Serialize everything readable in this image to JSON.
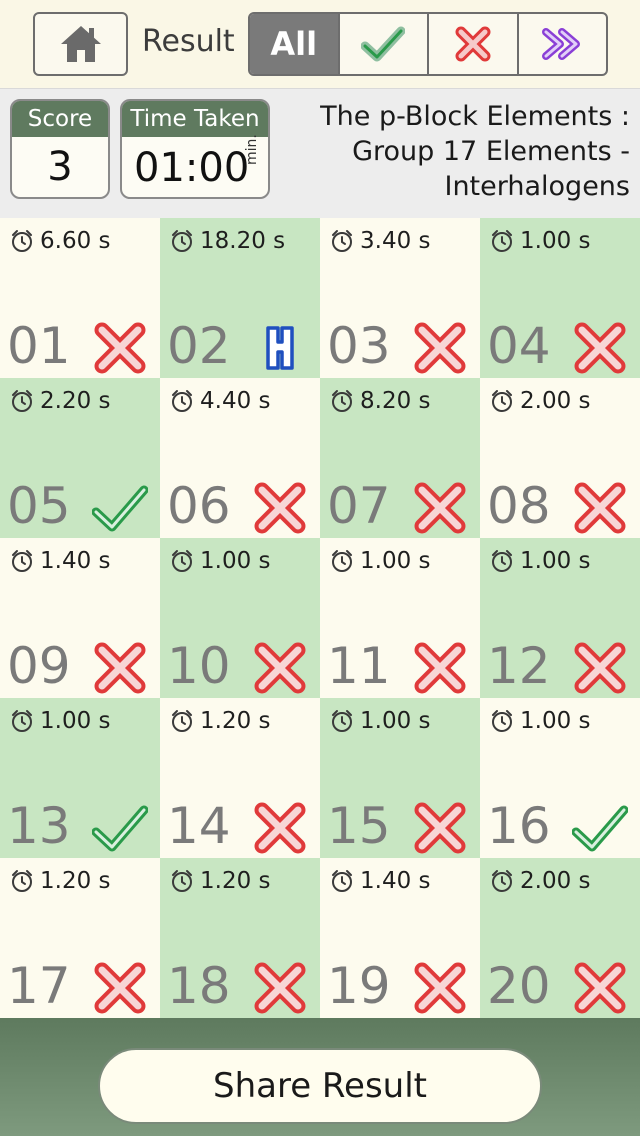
{
  "toolbar": {
    "result_label": "Result",
    "filters": [
      "All",
      "correct",
      "wrong",
      "skipped"
    ],
    "active_filter": "All"
  },
  "info": {
    "score_label": "Score",
    "score": "3",
    "time_label": "Time Taken",
    "time_value": "01:00",
    "time_unit": "min.",
    "topic_line1": "The p-Block Elements :",
    "topic_line2": "Group 17 Elements -",
    "topic_line3": "Interhalogens"
  },
  "questions": [
    {
      "num": "01",
      "time": "6.60 s",
      "status": "wrong",
      "bg": "light"
    },
    {
      "num": "02",
      "time": "18.20 s",
      "status": "hint",
      "bg": "green"
    },
    {
      "num": "03",
      "time": "3.40 s",
      "status": "wrong",
      "bg": "light"
    },
    {
      "num": "04",
      "time": "1.00 s",
      "status": "wrong",
      "bg": "green"
    },
    {
      "num": "05",
      "time": "2.20 s",
      "status": "correct",
      "bg": "green"
    },
    {
      "num": "06",
      "time": "4.40 s",
      "status": "wrong",
      "bg": "light"
    },
    {
      "num": "07",
      "time": "8.20 s",
      "status": "wrong",
      "bg": "green"
    },
    {
      "num": "08",
      "time": "2.00 s",
      "status": "wrong",
      "bg": "light"
    },
    {
      "num": "09",
      "time": "1.40 s",
      "status": "wrong",
      "bg": "light"
    },
    {
      "num": "10",
      "time": "1.00 s",
      "status": "wrong",
      "bg": "green"
    },
    {
      "num": "11",
      "time": "1.00 s",
      "status": "wrong",
      "bg": "light"
    },
    {
      "num": "12",
      "time": "1.00 s",
      "status": "wrong",
      "bg": "green"
    },
    {
      "num": "13",
      "time": "1.00 s",
      "status": "correct",
      "bg": "green"
    },
    {
      "num": "14",
      "time": "1.20 s",
      "status": "wrong",
      "bg": "light"
    },
    {
      "num": "15",
      "time": "1.00 s",
      "status": "wrong",
      "bg": "green"
    },
    {
      "num": "16",
      "time": "1.00 s",
      "status": "correct",
      "bg": "light"
    },
    {
      "num": "17",
      "time": "1.20 s",
      "status": "wrong",
      "bg": "light"
    },
    {
      "num": "18",
      "time": "1.20 s",
      "status": "wrong",
      "bg": "green"
    },
    {
      "num": "19",
      "time": "1.40 s",
      "status": "wrong",
      "bg": "light"
    },
    {
      "num": "20",
      "time": "2.00 s",
      "status": "wrong",
      "bg": "green"
    }
  ],
  "footer": {
    "share_label": "Share Result"
  },
  "colors": {
    "correct": "#2a9a4a",
    "wrong": "#e03a3a",
    "hint": "#1f4fbf",
    "skip": "#8a3fd6",
    "header_green": "#5f7a5f",
    "cell_green": "#c8e6c2",
    "cell_light": "#fdfbee"
  }
}
